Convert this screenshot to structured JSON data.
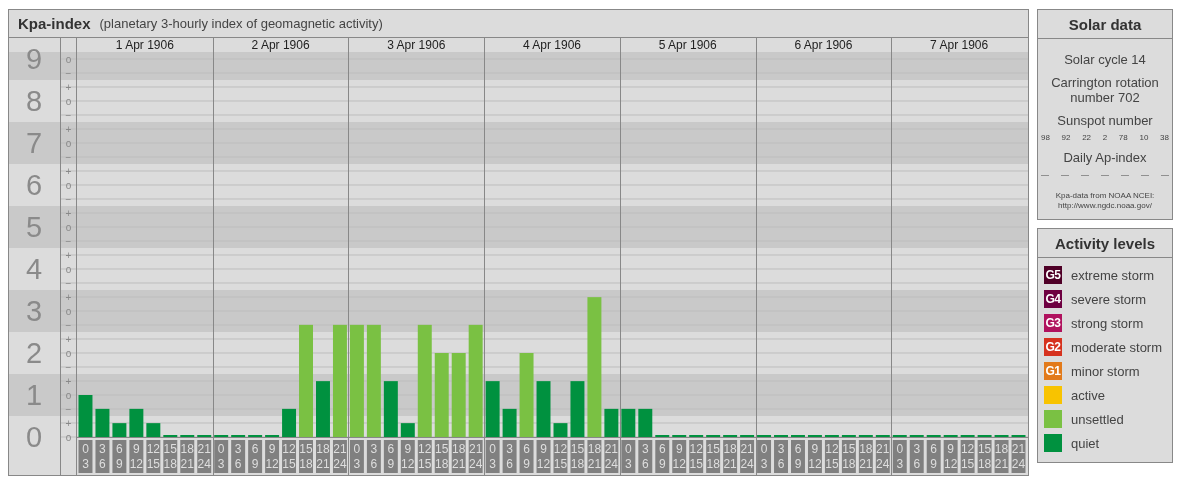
{
  "kp_panel": {
    "title": "Kpa-index",
    "subtitle": "(planetary 3-hourly index of geomagnetic activity)",
    "days": [
      "1 Apr 1906",
      "2 Apr 1906",
      "3 Apr 1906",
      "4 Apr 1906",
      "5 Apr 1906",
      "6 Apr 1906",
      "7 Apr 1906"
    ],
    "scale_marks": [
      "o",
      "−",
      "+",
      "o",
      "−",
      "+",
      "o",
      "−",
      "+",
      "o",
      "−",
      "+",
      "o",
      "−",
      "+",
      "o",
      "−",
      "+",
      "o",
      "−",
      "+",
      "o",
      "−",
      "+",
      "o",
      "−",
      "+",
      "o"
    ],
    "chart_data": {
      "type": "bar",
      "grid": true,
      "ylim": [
        0,
        9
      ],
      "yticks": [
        {
          "value": 0,
          "label": "0"
        },
        {
          "value": 1,
          "label": "1"
        },
        {
          "value": 2,
          "label": "2"
        },
        {
          "value": 3,
          "label": "3"
        },
        {
          "value": 4,
          "label": "4"
        },
        {
          "value": 5,
          "label": "5"
        },
        {
          "value": 6,
          "label": "6"
        },
        {
          "value": 7,
          "label": "7"
        },
        {
          "value": 8,
          "label": "8"
        },
        {
          "value": 9,
          "label": "9"
        }
      ],
      "categories": [
        "0 3",
        "3 6",
        "6 9",
        "9 12",
        "12 15",
        "15 18",
        "18 21",
        "21 24",
        "0 3",
        "3 6",
        "6 9",
        "9 12",
        "12 15",
        "15 18",
        "18 21",
        "21 24",
        "0 3",
        "3 6",
        "6 9",
        "9 12",
        "12 15",
        "15 18",
        "18 21",
        "21 24",
        "0 3",
        "3 6",
        "6 9",
        "9 12",
        "12 15",
        "15 18",
        "18 21",
        "21 24",
        "0 3",
        "3 6",
        "6 9",
        "9 12",
        "12 15",
        "15 18",
        "18 21",
        "21 24",
        "0 3",
        "3 6",
        "6 9",
        "9 12",
        "12 15",
        "15 18",
        "18 21",
        "21 24",
        "0 3",
        "3 6",
        "6 9",
        "9 12",
        "12 15",
        "15 18",
        "18 21",
        "21 24"
      ],
      "series": [
        {
          "color": "#00913f",
          "values": [
            1,
            0.67,
            0.33,
            0.67,
            0.33,
            0,
            0,
            0,
            0,
            0,
            0,
            0,
            0.67,
            null,
            1.33,
            null,
            null,
            null,
            1.33,
            0.33,
            null,
            null,
            null,
            null,
            1.33,
            0.67,
            null,
            1.33,
            0.33,
            1.33,
            null,
            0.67,
            0.67,
            0.67,
            0,
            0,
            0,
            0,
            0,
            0,
            0,
            0,
            0,
            0,
            0,
            0,
            0,
            0,
            0,
            0,
            0,
            0,
            0,
            0,
            0,
            0
          ]
        },
        {
          "color": "#7ac143",
          "values": [
            null,
            null,
            null,
            null,
            null,
            null,
            null,
            null,
            null,
            null,
            null,
            null,
            null,
            2.67,
            null,
            2.67,
            2.67,
            2.67,
            null,
            null,
            2.67,
            2,
            2,
            2.67,
            null,
            null,
            2,
            null,
            null,
            null,
            3.33,
            null,
            null,
            null,
            null,
            null,
            null,
            null,
            null,
            null,
            null,
            null,
            null,
            null,
            null,
            null,
            null,
            null,
            null,
            null,
            null,
            null,
            null,
            null,
            null,
            null
          ]
        }
      ]
    }
  },
  "solar_data": {
    "title": "Solar data",
    "solar_cycle": "Solar cycle 14",
    "carrington": "Carrington rotation number 702",
    "sunspot_title": "Sunspot number",
    "sunspot_numbers": [
      "98",
      "92",
      "22",
      "2",
      "78",
      "10",
      "38"
    ],
    "ap_title": "Daily Ap-index",
    "ap_values": [
      "—",
      "—",
      "—",
      "—",
      "—",
      "—",
      "—"
    ],
    "source": "Kpa-data from NOAA NCEI:",
    "source_url": "http://www.ngdc.noaa.gov/"
  },
  "activity_levels": {
    "title": "Activity levels",
    "items": [
      {
        "badge": "G5",
        "label": "extreme storm",
        "color": "#4f0027"
      },
      {
        "badge": "G4",
        "label": "severe storm",
        "color": "#6e0041"
      },
      {
        "badge": "G3",
        "label": "strong storm",
        "color": "#b0125e"
      },
      {
        "badge": "G2",
        "label": "moderate storm",
        "color": "#d6321e"
      },
      {
        "badge": "G1",
        "label": "minor storm",
        "color": "#e27a1a"
      },
      {
        "label": "active",
        "color": "#f8c300"
      },
      {
        "label": "unsettled",
        "color": "#7ac143"
      },
      {
        "label": "quiet",
        "color": "#00913f"
      }
    ]
  }
}
